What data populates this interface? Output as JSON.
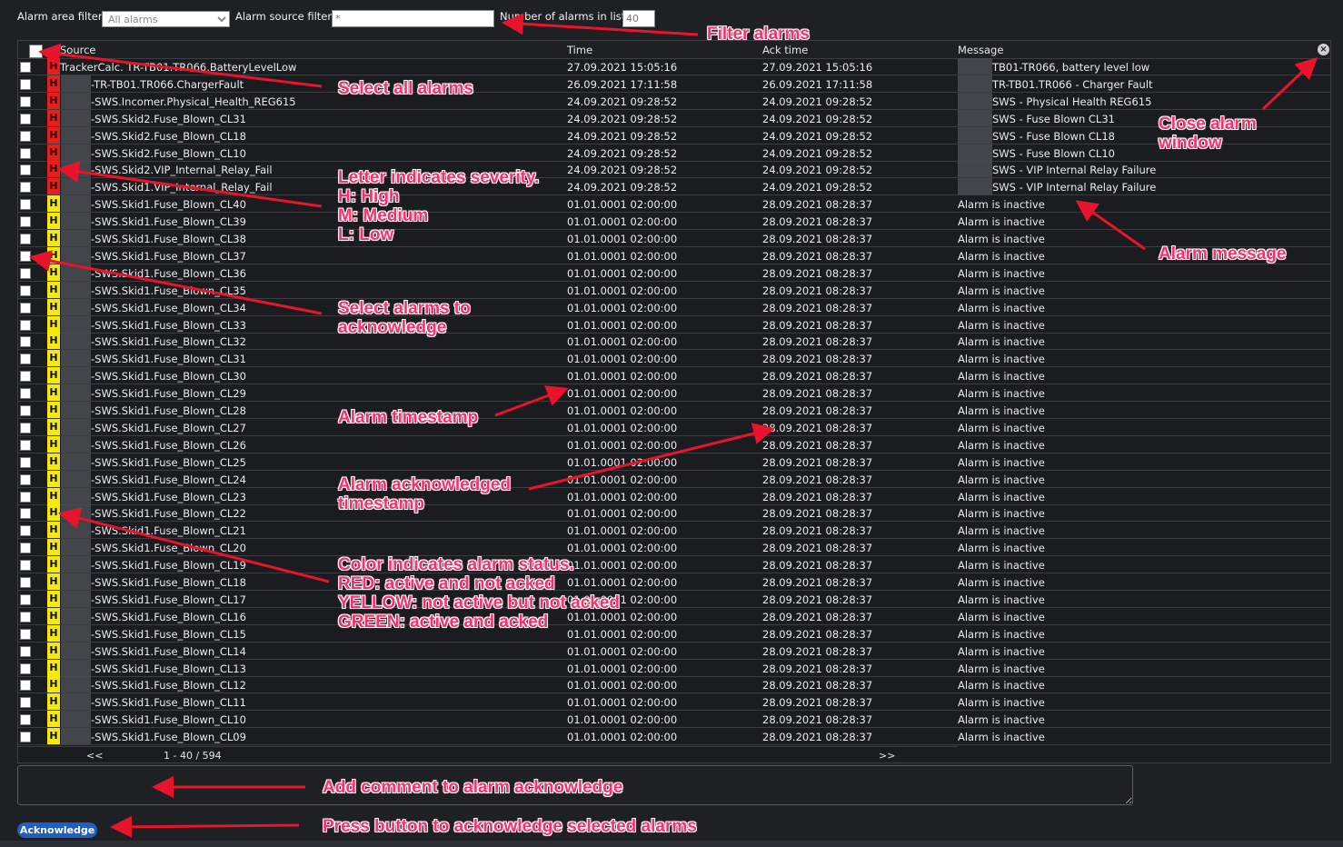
{
  "filters": {
    "area_label": "Alarm area filter:",
    "area_value": "All alarms",
    "source_label": "Alarm source filter:",
    "source_value": "*",
    "count_label": "Number of alarms in list:",
    "count_value": "40"
  },
  "columns": {
    "source": "Source",
    "time": "Time",
    "ack": "Ack time",
    "message": "Message"
  },
  "close_icon": "×",
  "rows": [
    {
      "sev": "H",
      "color": "red",
      "source": "TrackerCalc.            TR-TB01.TR066.BatteryLevelLow",
      "time": "27.09.2021 15:05:16",
      "ack": "27.09.2021 15:05:16",
      "msg": "TB01-TR066, battery level low",
      "blur_msg": true,
      "first": true
    },
    {
      "sev": "H",
      "color": "red",
      "source": "-TR-TB01.TR066.ChargerFault",
      "time": "26.09.2021 17:11:58",
      "ack": "26.09.2021 17:11:58",
      "msg": "TR-TB01.TR066 - Charger Fault",
      "blur_msg": true
    },
    {
      "sev": "H",
      "color": "red",
      "source": "-SWS.Incomer.Physical_Health_REG615",
      "time": "24.09.2021 09:28:52",
      "ack": "24.09.2021 09:28:52",
      "msg": "SWS - Physical Health REG615",
      "blur_msg": true
    },
    {
      "sev": "H",
      "color": "red",
      "source": "-SWS.Skid2.Fuse_Blown_CL31",
      "time": "24.09.2021 09:28:52",
      "ack": "24.09.2021 09:28:52",
      "msg": "SWS - Fuse Blown CL31",
      "blur_msg": true
    },
    {
      "sev": "H",
      "color": "red",
      "source": "-SWS.Skid2.Fuse_Blown_CL18",
      "time": "24.09.2021 09:28:52",
      "ack": "24.09.2021 09:28:52",
      "msg": "SWS - Fuse Blown CL18",
      "blur_msg": true
    },
    {
      "sev": "H",
      "color": "red",
      "source": "-SWS.Skid2.Fuse_Blown_CL10",
      "time": "24.09.2021 09:28:52",
      "ack": "24.09.2021 09:28:52",
      "msg": "SWS - Fuse Blown CL10",
      "blur_msg": true
    },
    {
      "sev": "H",
      "color": "red",
      "source": "-SWS.Skid2.VIP_Internal_Relay_Fail",
      "time": "24.09.2021 09:28:52",
      "ack": "24.09.2021 09:28:52",
      "msg": "SWS - VIP Internal Relay Failure",
      "blur_msg": true
    },
    {
      "sev": "H",
      "color": "red",
      "source": "-SWS.Skid1.VIP_Internal_Relay_Fail",
      "time": "24.09.2021 09:28:52",
      "ack": "24.09.2021 09:28:52",
      "msg": "SWS - VIP Internal Relay Failure",
      "blur_msg": true
    },
    {
      "sev": "H",
      "color": "yellow",
      "source": "-SWS.Skid1.Fuse_Blown_CL40",
      "time": "01.01.0001 02:00:00",
      "ack": "28.09.2021 08:28:37",
      "msg": "Alarm is inactive"
    },
    {
      "sev": "H",
      "color": "yellow",
      "source": "-SWS.Skid1.Fuse_Blown_CL39",
      "time": "01.01.0001 02:00:00",
      "ack": "28.09.2021 08:28:37",
      "msg": "Alarm is inactive"
    },
    {
      "sev": "H",
      "color": "yellow",
      "source": "-SWS.Skid1.Fuse_Blown_CL38",
      "time": "01.01.0001 02:00:00",
      "ack": "28.09.2021 08:28:37",
      "msg": "Alarm is inactive"
    },
    {
      "sev": "H",
      "color": "yellow",
      "source": "-SWS.Skid1.Fuse_Blown_CL37",
      "time": "01.01.0001 02:00:00",
      "ack": "28.09.2021 08:28:37",
      "msg": "Alarm is inactive"
    },
    {
      "sev": "H",
      "color": "yellow",
      "source": "-SWS.Skid1.Fuse_Blown_CL36",
      "time": "01.01.0001 02:00:00",
      "ack": "28.09.2021 08:28:37",
      "msg": "Alarm is inactive"
    },
    {
      "sev": "H",
      "color": "yellow",
      "source": "-SWS.Skid1.Fuse_Blown_CL35",
      "time": "01.01.0001 02:00:00",
      "ack": "28.09.2021 08:28:37",
      "msg": "Alarm is inactive"
    },
    {
      "sev": "H",
      "color": "yellow",
      "source": "-SWS.Skid1.Fuse_Blown_CL34",
      "time": "01.01.0001 02:00:00",
      "ack": "28.09.2021 08:28:37",
      "msg": "Alarm is inactive"
    },
    {
      "sev": "H",
      "color": "yellow",
      "source": "-SWS.Skid1.Fuse_Blown_CL33",
      "time": "01.01.0001 02:00:00",
      "ack": "28.09.2021 08:28:37",
      "msg": "Alarm is inactive"
    },
    {
      "sev": "H",
      "color": "yellow",
      "source": "-SWS.Skid1.Fuse_Blown_CL32",
      "time": "01.01.0001 02:00:00",
      "ack": "28.09.2021 08:28:37",
      "msg": "Alarm is inactive"
    },
    {
      "sev": "H",
      "color": "yellow",
      "source": "-SWS.Skid1.Fuse_Blown_CL31",
      "time": "01.01.0001 02:00:00",
      "ack": "28.09.2021 08:28:37",
      "msg": "Alarm is inactive"
    },
    {
      "sev": "H",
      "color": "yellow",
      "source": "-SWS.Skid1.Fuse_Blown_CL30",
      "time": "01.01.0001 02:00:00",
      "ack": "28.09.2021 08:28:37",
      "msg": "Alarm is inactive"
    },
    {
      "sev": "H",
      "color": "yellow",
      "source": "-SWS.Skid1.Fuse_Blown_CL29",
      "time": "01.01.0001 02:00:00",
      "ack": "28.09.2021 08:28:37",
      "msg": "Alarm is inactive"
    },
    {
      "sev": "H",
      "color": "yellow",
      "source": "-SWS.Skid1.Fuse_Blown_CL28",
      "time": "01.01.0001 02:00:00",
      "ack": "28.09.2021 08:28:37",
      "msg": "Alarm is inactive"
    },
    {
      "sev": "H",
      "color": "yellow",
      "source": "-SWS.Skid1.Fuse_Blown_CL27",
      "time": "01.01.0001 02:00:00",
      "ack": "28.09.2021 08:28:37",
      "msg": "Alarm is inactive"
    },
    {
      "sev": "H",
      "color": "yellow",
      "source": "-SWS.Skid1.Fuse_Blown_CL26",
      "time": "01.01.0001 02:00:00",
      "ack": "28.09.2021 08:28:37",
      "msg": "Alarm is inactive"
    },
    {
      "sev": "H",
      "color": "yellow",
      "source": "-SWS.Skid1.Fuse_Blown_CL25",
      "time": "01.01.0001 02:00:00",
      "ack": "28.09.2021 08:28:37",
      "msg": "Alarm is inactive"
    },
    {
      "sev": "H",
      "color": "yellow",
      "source": "-SWS.Skid1.Fuse_Blown_CL24",
      "time": "01.01.0001 02:00:00",
      "ack": "28.09.2021 08:28:37",
      "msg": "Alarm is inactive"
    },
    {
      "sev": "H",
      "color": "yellow",
      "source": "-SWS.Skid1.Fuse_Blown_CL23",
      "time": "01.01.0001 02:00:00",
      "ack": "28.09.2021 08:28:37",
      "msg": "Alarm is inactive"
    },
    {
      "sev": "H",
      "color": "yellow",
      "source": "-SWS.Skid1.Fuse_Blown_CL22",
      "time": "01.01.0001 02:00:00",
      "ack": "28.09.2021 08:28:37",
      "msg": "Alarm is inactive"
    },
    {
      "sev": "H",
      "color": "yellow",
      "source": "-SWS.Skid1.Fuse_Blown_CL21",
      "time": "01.01.0001 02:00:00",
      "ack": "28.09.2021 08:28:37",
      "msg": "Alarm is inactive"
    },
    {
      "sev": "H",
      "color": "yellow",
      "source": "-SWS.Skid1.Fuse_Blown_CL20",
      "time": "01.01.0001 02:00:00",
      "ack": "28.09.2021 08:28:37",
      "msg": "Alarm is inactive"
    },
    {
      "sev": "H",
      "color": "yellow",
      "source": "-SWS.Skid1.Fuse_Blown_CL19",
      "time": "01.01.0001 02:00:00",
      "ack": "28.09.2021 08:28:37",
      "msg": "Alarm is inactive"
    },
    {
      "sev": "H",
      "color": "yellow",
      "source": "-SWS.Skid1.Fuse_Blown_CL18",
      "time": "01.01.0001 02:00:00",
      "ack": "28.09.2021 08:28:37",
      "msg": "Alarm is inactive"
    },
    {
      "sev": "H",
      "color": "yellow",
      "source": "-SWS.Skid1.Fuse_Blown_CL17",
      "time": "01.01.0001 02:00:00",
      "ack": "28.09.2021 08:28:37",
      "msg": "Alarm is inactive"
    },
    {
      "sev": "H",
      "color": "yellow",
      "source": "-SWS.Skid1.Fuse_Blown_CL16",
      "time": "01.01.0001 02:00:00",
      "ack": "28.09.2021 08:28:37",
      "msg": "Alarm is inactive"
    },
    {
      "sev": "H",
      "color": "yellow",
      "source": "-SWS.Skid1.Fuse_Blown_CL15",
      "time": "01.01.0001 02:00:00",
      "ack": "28.09.2021 08:28:37",
      "msg": "Alarm is inactive"
    },
    {
      "sev": "H",
      "color": "yellow",
      "source": "-SWS.Skid1.Fuse_Blown_CL14",
      "time": "01.01.0001 02:00:00",
      "ack": "28.09.2021 08:28:37",
      "msg": "Alarm is inactive"
    },
    {
      "sev": "H",
      "color": "yellow",
      "source": "-SWS.Skid1.Fuse_Blown_CL13",
      "time": "01.01.0001 02:00:00",
      "ack": "28.09.2021 08:28:37",
      "msg": "Alarm is inactive"
    },
    {
      "sev": "H",
      "color": "yellow",
      "source": "-SWS.Skid1.Fuse_Blown_CL12",
      "time": "01.01.0001 02:00:00",
      "ack": "28.09.2021 08:28:37",
      "msg": "Alarm is inactive"
    },
    {
      "sev": "H",
      "color": "yellow",
      "source": "-SWS.Skid1.Fuse_Blown_CL11",
      "time": "01.01.0001 02:00:00",
      "ack": "28.09.2021 08:28:37",
      "msg": "Alarm is inactive"
    },
    {
      "sev": "H",
      "color": "yellow",
      "source": "-SWS.Skid1.Fuse_Blown_CL10",
      "time": "01.01.0001 02:00:00",
      "ack": "28.09.2021 08:28:37",
      "msg": "Alarm is inactive"
    },
    {
      "sev": "H",
      "color": "yellow",
      "source": "-SWS.Skid1.Fuse_Blown_CL09",
      "time": "01.01.0001 02:00:00",
      "ack": "28.09.2021 08:28:37",
      "msg": "Alarm is inactive"
    }
  ],
  "pager": {
    "prev": "<<",
    "range": "1 - 40 / 594",
    "next": ">>"
  },
  "ack_button": "Acknowledge",
  "colors": {
    "red": "#e3201b",
    "yellow": "#f5e90a",
    "annotation": "#ff2d6a",
    "button": "#1f5fbf"
  },
  "annotations": {
    "filter": "Filter alarms",
    "select_all": "Select all alarms",
    "close": [
      "Close alarm",
      "window"
    ],
    "severity": [
      "Letter indicates severity.",
      "H: High",
      "M: Medium",
      "L: Low"
    ],
    "message": "Alarm message",
    "select_ack": [
      "Select alarms to",
      "acknowledge"
    ],
    "timestamp": "Alarm timestamp",
    "ack_timestamp": [
      "Alarm acknowledged",
      "timestamp"
    ],
    "color": [
      "Color indicates alarm status.",
      "RED: active and not acked",
      "YELLOW: not active but not acked",
      "GREEN: active and acked"
    ],
    "comment": "Add comment to alarm acknowledge",
    "press": "Press button to acknowledge selected alarms"
  }
}
